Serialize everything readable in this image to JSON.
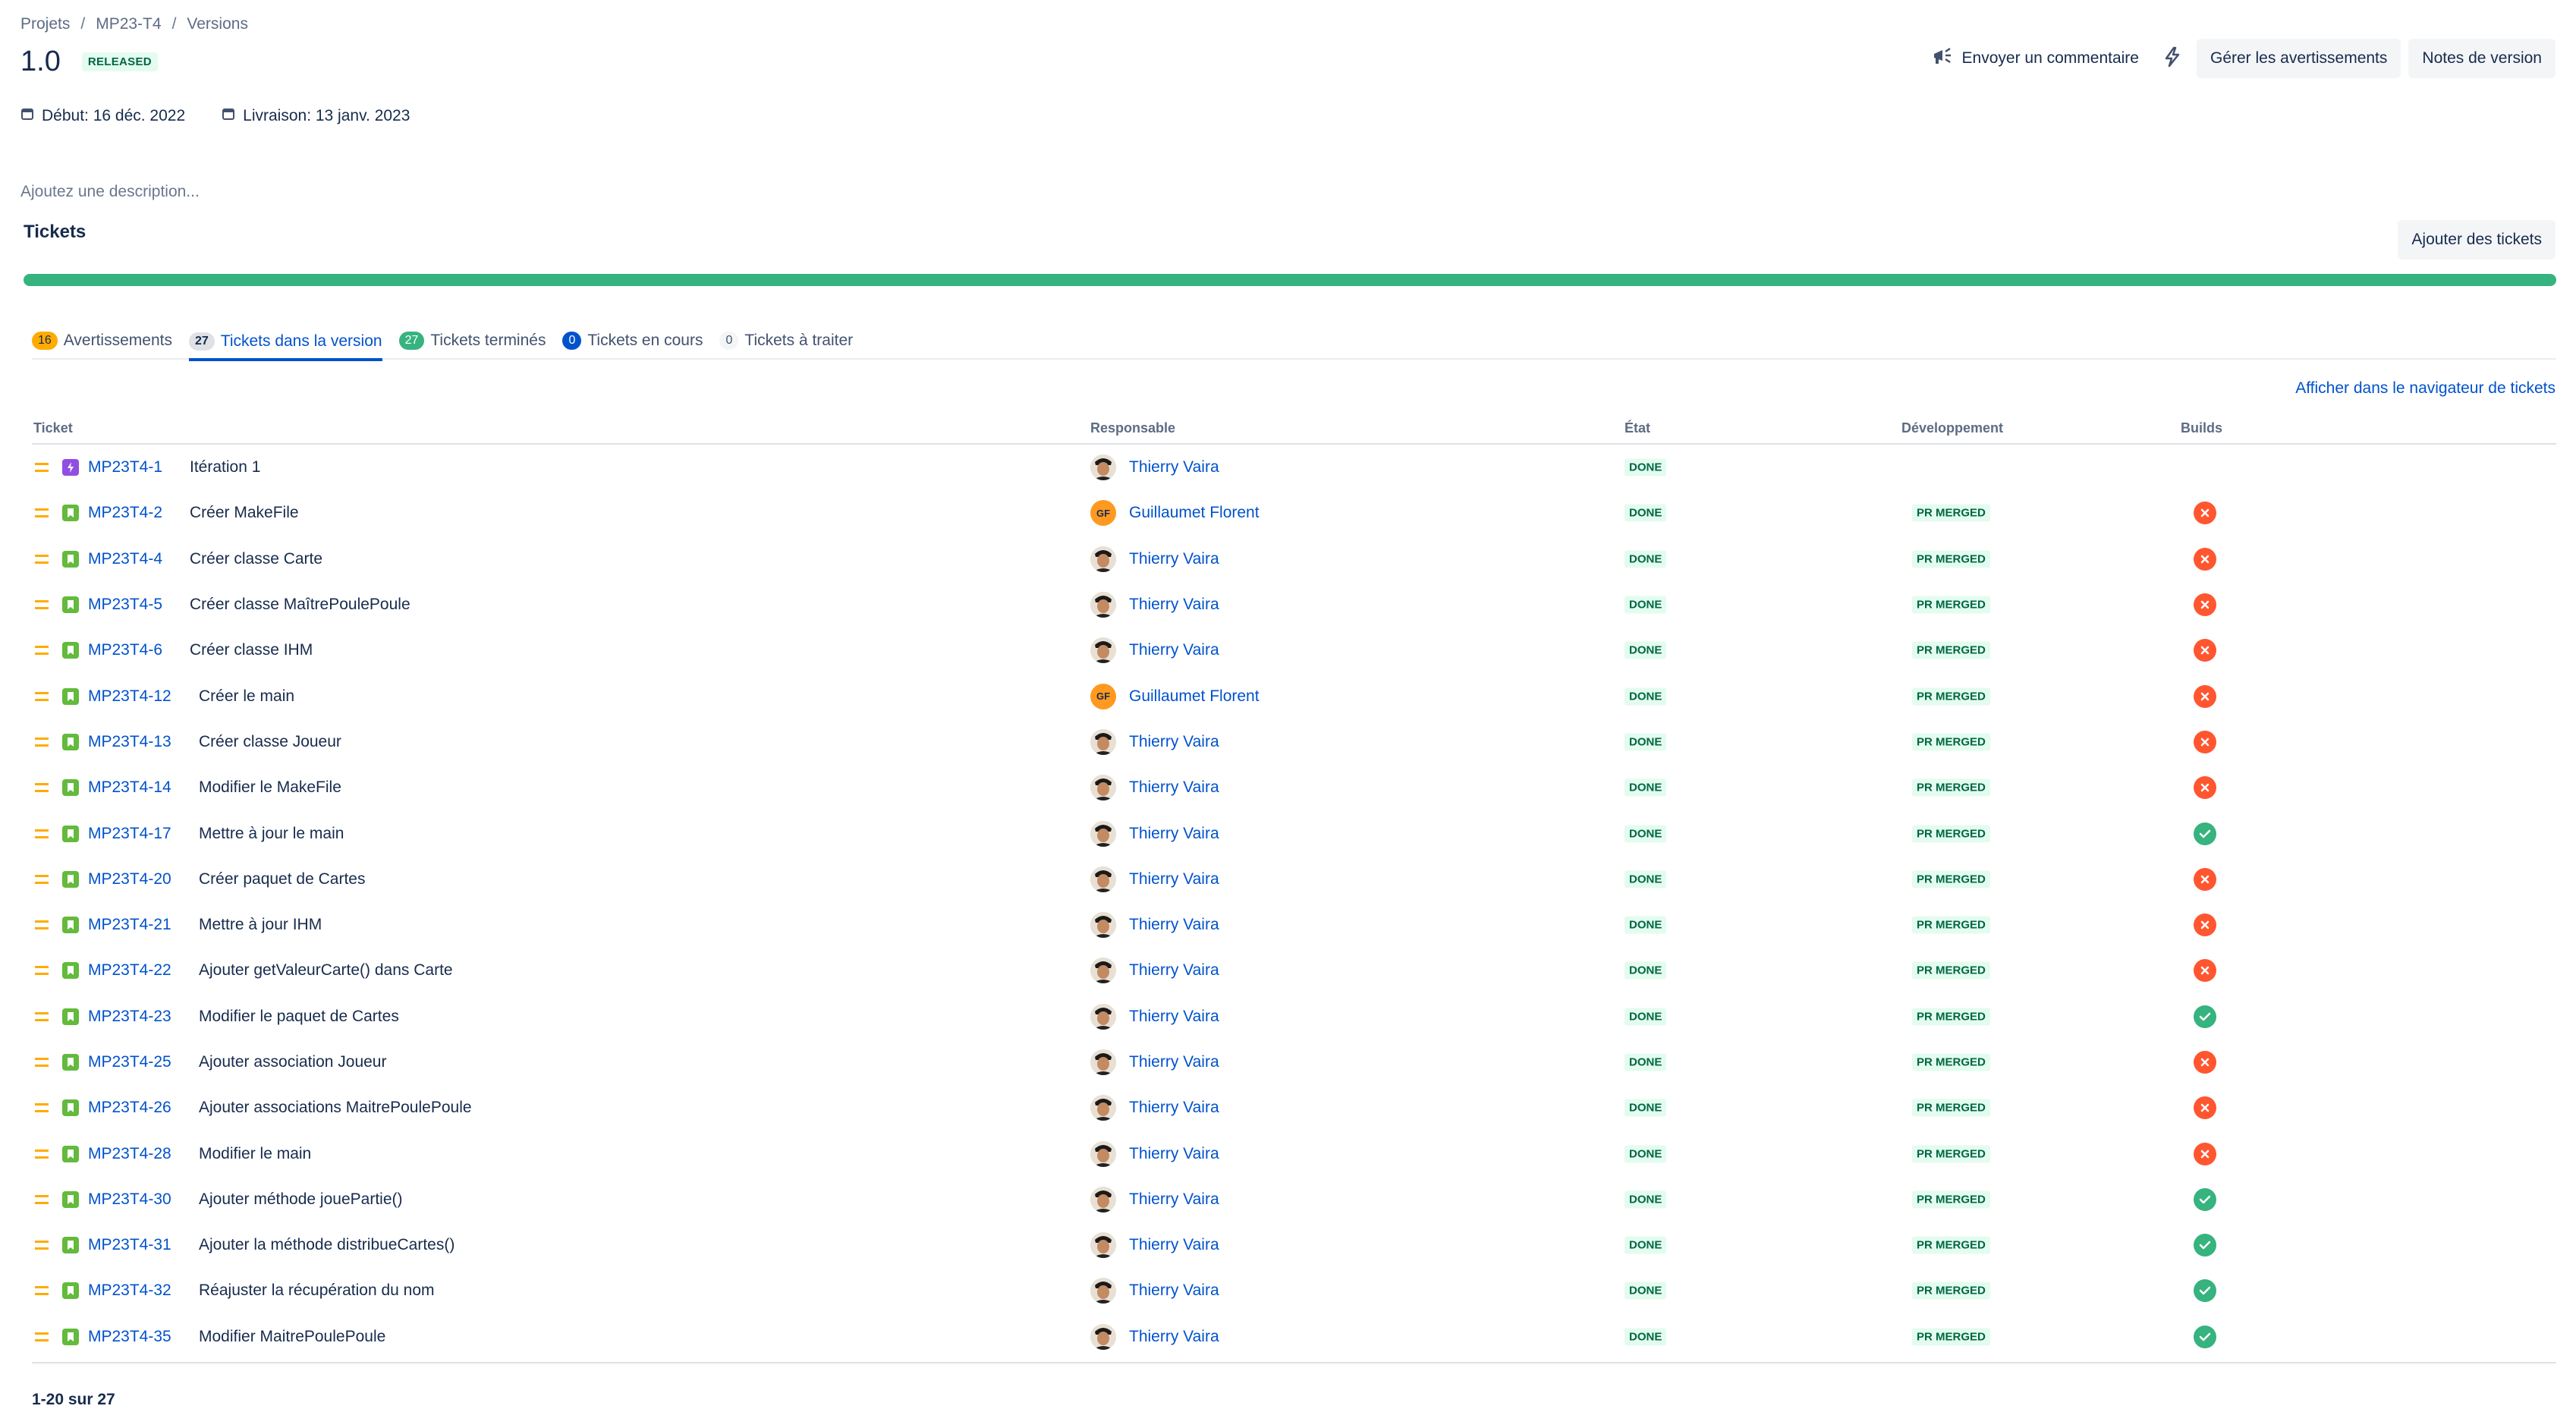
{
  "breadcrumb": [
    "Projets",
    "MP23-T4",
    "Versions"
  ],
  "version": {
    "name": "1.0",
    "status": "RELEASED"
  },
  "actions": {
    "feedback": "Envoyer un commentaire",
    "manage_warnings": "Gérer les avertissements",
    "release_notes": "Notes de version",
    "add_tickets": "Ajouter des tickets"
  },
  "dates": {
    "start": "Début: 16 déc. 2022",
    "release": "Livraison: 13 janv. 2023"
  },
  "description_placeholder": "Ajoutez une description...",
  "section_title": "Tickets",
  "progress_done_fraction": 1.0,
  "tabs": [
    {
      "count": "16",
      "label": "Avertissements"
    },
    {
      "count": "27",
      "label": "Tickets dans la version"
    },
    {
      "count": "27",
      "label": "Tickets terminés"
    },
    {
      "count": "0",
      "label": "Tickets en cours"
    },
    {
      "count": "0",
      "label": "Tickets à traiter"
    }
  ],
  "navigator_link": "Afficher dans le navigateur de tickets",
  "columns": [
    "Ticket",
    "Responsable",
    "État",
    "Développement",
    "Builds"
  ],
  "rows": [
    {
      "key": "MP23T4-1",
      "summary": "Itération 1",
      "type": "epic",
      "assignee": "Thierry Vaira",
      "avatar": "photo",
      "status": "DONE",
      "dev": "",
      "build": ""
    },
    {
      "key": "MP23T4-2",
      "summary": "Créer MakeFile",
      "type": "story",
      "assignee": "Guillaumet Florent",
      "avatar": "GF",
      "status": "DONE",
      "dev": "PR MERGED",
      "build": "fail"
    },
    {
      "key": "MP23T4-4",
      "summary": "Créer classe Carte",
      "type": "story",
      "assignee": "Thierry Vaira",
      "avatar": "photo",
      "status": "DONE",
      "dev": "PR MERGED",
      "build": "fail"
    },
    {
      "key": "MP23T4-5",
      "summary": "Créer classe MaîtrePoulePoule",
      "type": "story",
      "assignee": "Thierry Vaira",
      "avatar": "photo",
      "status": "DONE",
      "dev": "PR MERGED",
      "build": "fail"
    },
    {
      "key": "MP23T4-6",
      "summary": "Créer classe IHM",
      "type": "story",
      "assignee": "Thierry Vaira",
      "avatar": "photo",
      "status": "DONE",
      "dev": "PR MERGED",
      "build": "fail"
    },
    {
      "key": "MP23T4-12",
      "summary": "Créer le main",
      "type": "story",
      "assignee": "Guillaumet Florent",
      "avatar": "GF",
      "status": "DONE",
      "dev": "PR MERGED",
      "build": "fail"
    },
    {
      "key": "MP23T4-13",
      "summary": "Créer classe Joueur",
      "type": "story",
      "assignee": "Thierry Vaira",
      "avatar": "photo",
      "status": "DONE",
      "dev": "PR MERGED",
      "build": "fail"
    },
    {
      "key": "MP23T4-14",
      "summary": "Modifier le MakeFile",
      "type": "story",
      "assignee": "Thierry Vaira",
      "avatar": "photo",
      "status": "DONE",
      "dev": "PR MERGED",
      "build": "fail"
    },
    {
      "key": "MP23T4-17",
      "summary": "Mettre à jour le main",
      "type": "story",
      "assignee": "Thierry Vaira",
      "avatar": "photo",
      "status": "DONE",
      "dev": "PR MERGED",
      "build": "ok"
    },
    {
      "key": "MP23T4-20",
      "summary": "Créer paquet de Cartes",
      "type": "story",
      "assignee": "Thierry Vaira",
      "avatar": "photo",
      "status": "DONE",
      "dev": "PR MERGED",
      "build": "fail"
    },
    {
      "key": "MP23T4-21",
      "summary": "Mettre à jour IHM",
      "type": "story",
      "assignee": "Thierry Vaira",
      "avatar": "photo",
      "status": "DONE",
      "dev": "PR MERGED",
      "build": "fail"
    },
    {
      "key": "MP23T4-22",
      "summary": "Ajouter getValeurCarte() dans Carte",
      "type": "story",
      "assignee": "Thierry Vaira",
      "avatar": "photo",
      "status": "DONE",
      "dev": "PR MERGED",
      "build": "fail"
    },
    {
      "key": "MP23T4-23",
      "summary": "Modifier le paquet de Cartes",
      "type": "story",
      "assignee": "Thierry Vaira",
      "avatar": "photo",
      "status": "DONE",
      "dev": "PR MERGED",
      "build": "ok"
    },
    {
      "key": "MP23T4-25",
      "summary": "Ajouter association Joueur",
      "type": "story",
      "assignee": "Thierry Vaira",
      "avatar": "photo",
      "status": "DONE",
      "dev": "PR MERGED",
      "build": "fail"
    },
    {
      "key": "MP23T4-26",
      "summary": "Ajouter associations MaitrePoulePoule",
      "type": "story",
      "assignee": "Thierry Vaira",
      "avatar": "photo",
      "status": "DONE",
      "dev": "PR MERGED",
      "build": "fail"
    },
    {
      "key": "MP23T4-28",
      "summary": "Modifier le main",
      "type": "story",
      "assignee": "Thierry Vaira",
      "avatar": "photo",
      "status": "DONE",
      "dev": "PR MERGED",
      "build": "fail"
    },
    {
      "key": "MP23T4-30",
      "summary": "Ajouter méthode jouePartie()",
      "type": "story",
      "assignee": "Thierry Vaira",
      "avatar": "photo",
      "status": "DONE",
      "dev": "PR MERGED",
      "build": "ok"
    },
    {
      "key": "MP23T4-31",
      "summary": "Ajouter la méthode distribueCartes()",
      "type": "story",
      "assignee": "Thierry Vaira",
      "avatar": "photo",
      "status": "DONE",
      "dev": "PR MERGED",
      "build": "ok"
    },
    {
      "key": "MP23T4-32",
      "summary": "Réajuster la récupération du nom",
      "type": "story",
      "assignee": "Thierry Vaira",
      "avatar": "photo",
      "status": "DONE",
      "dev": "PR MERGED",
      "build": "ok"
    },
    {
      "key": "MP23T4-35",
      "summary": "Modifier MaitrePoulePoule",
      "type": "story",
      "assignee": "Thierry Vaira",
      "avatar": "photo",
      "status": "DONE",
      "dev": "PR MERGED",
      "build": "ok"
    }
  ],
  "pagination": "1-20 sur 27",
  "colors": {
    "accent": "#0052cc",
    "success": "#36b37e",
    "danger": "#ff5630",
    "warning": "#ffab00"
  }
}
